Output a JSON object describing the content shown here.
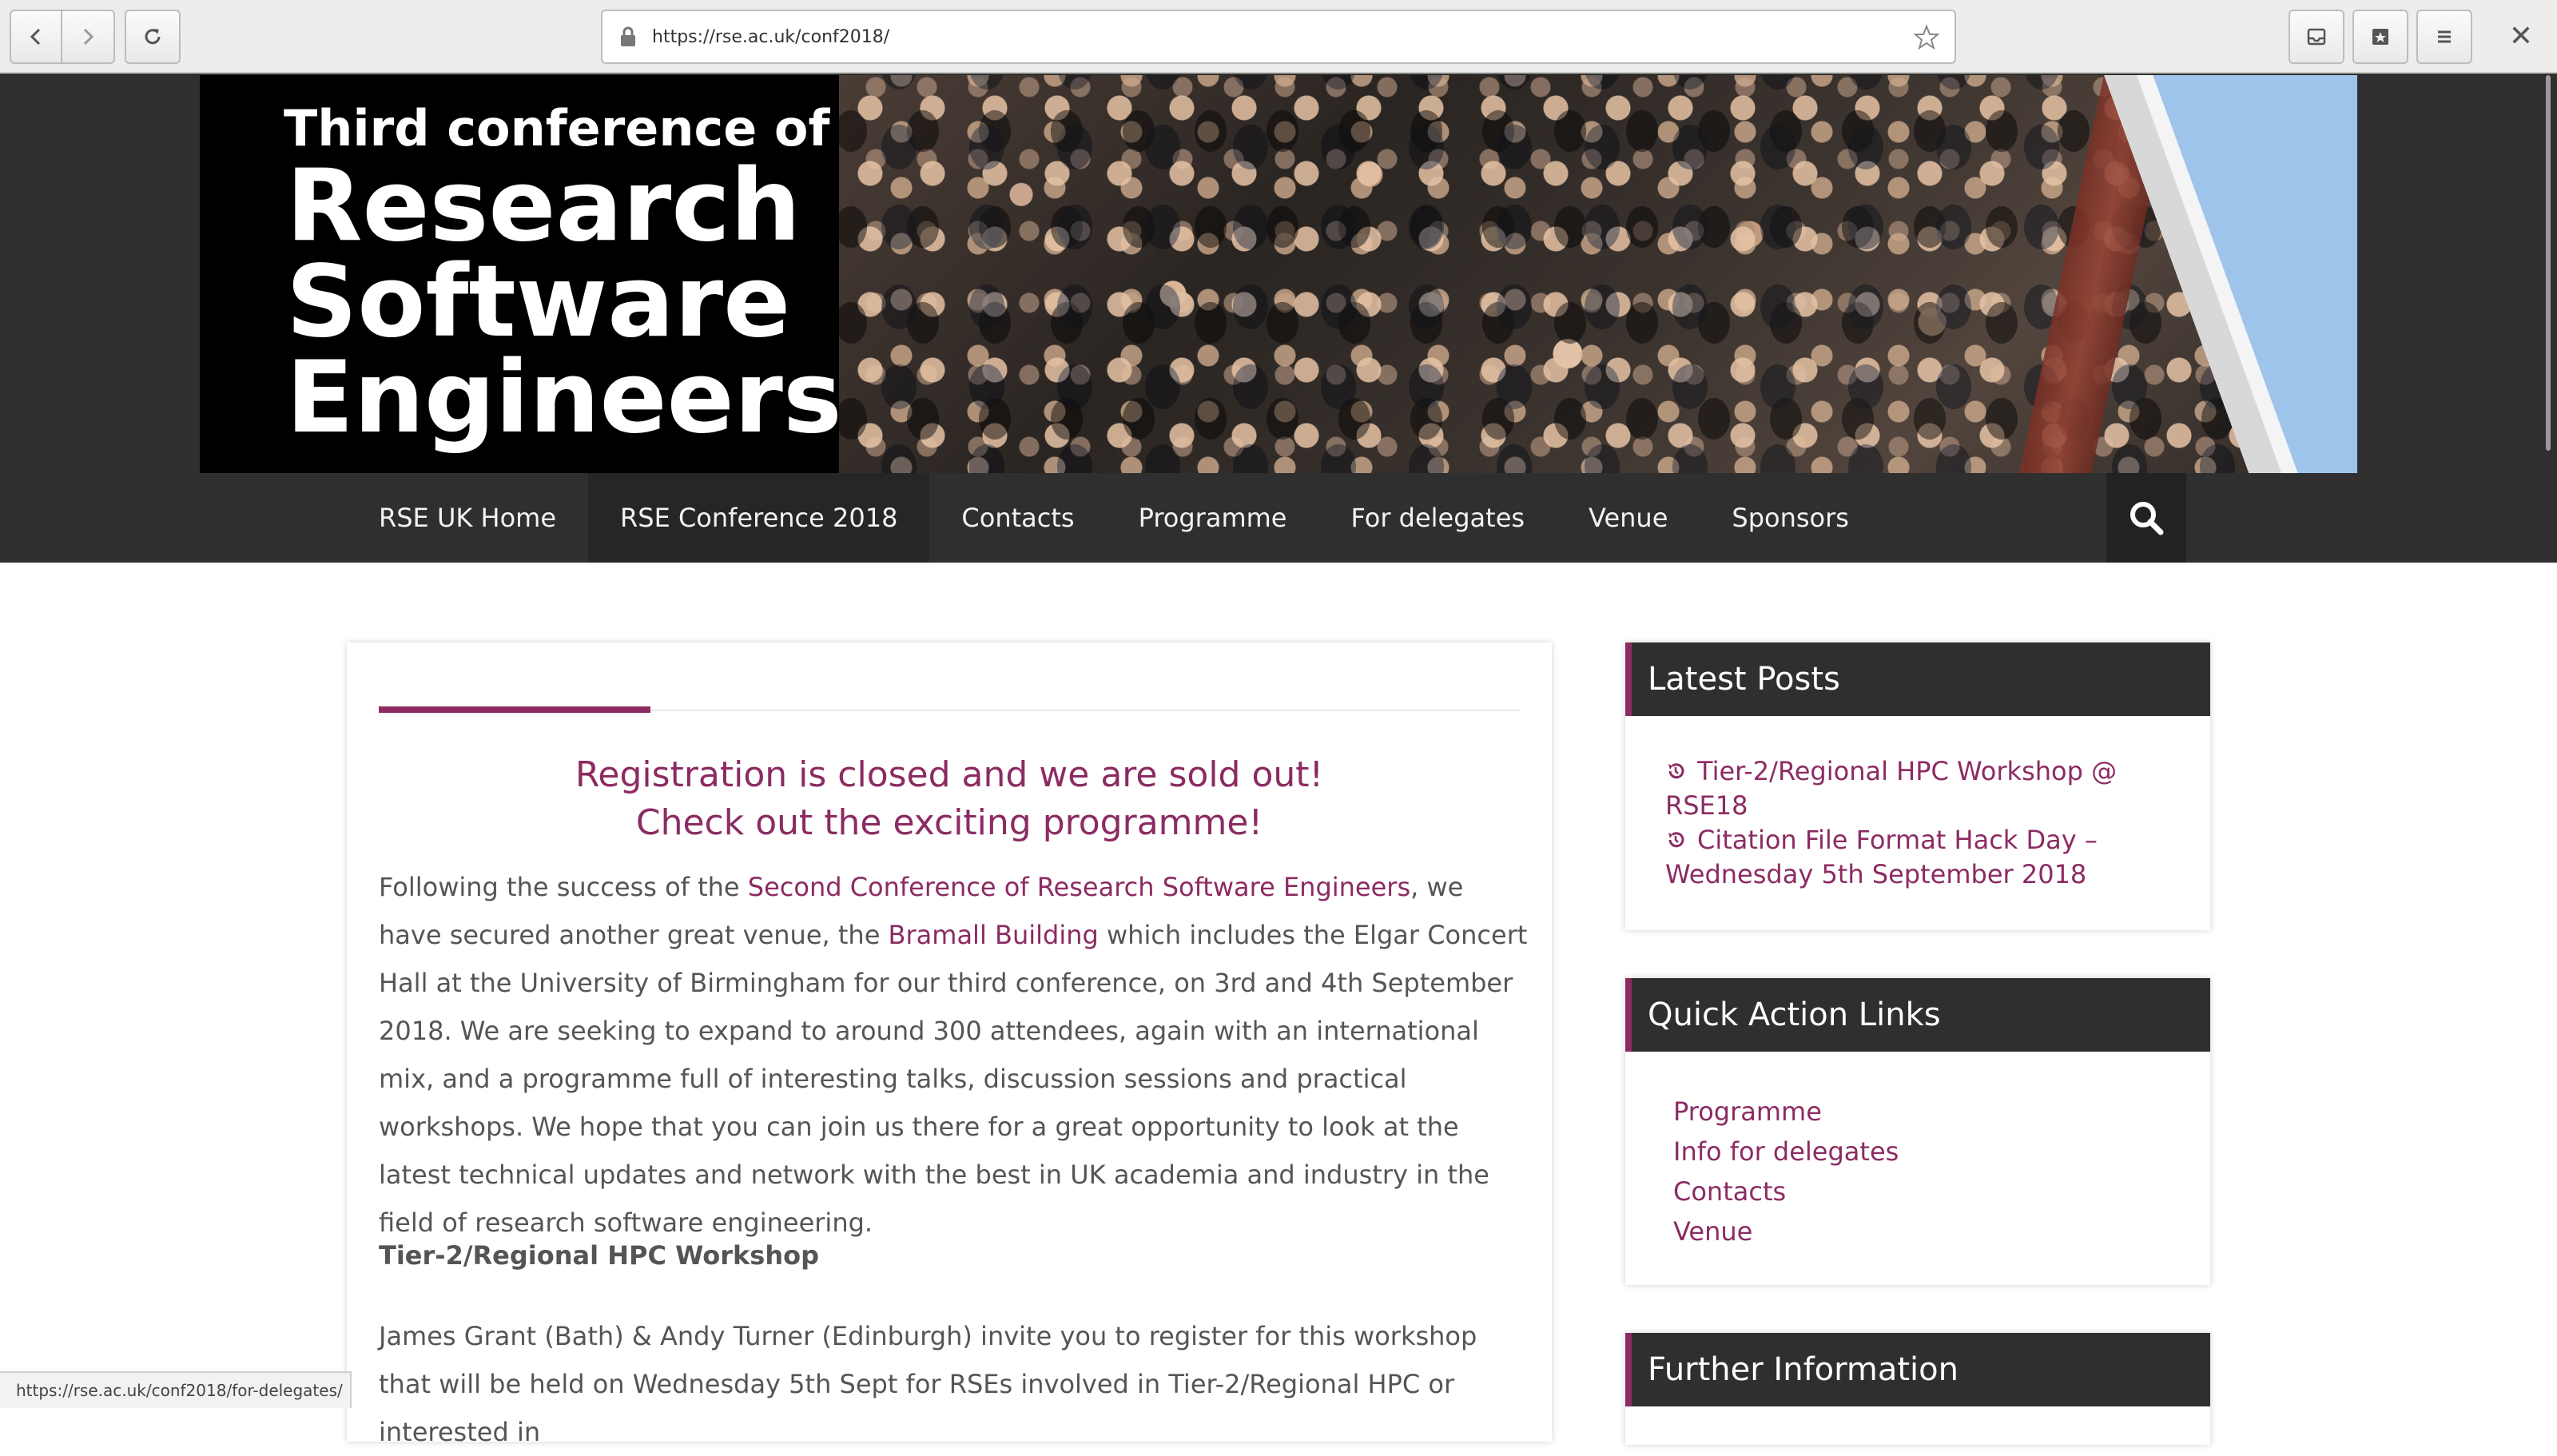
{
  "browser": {
    "url": "https://rse.ac.uk/conf2018/",
    "status_url": "https://rse.ac.uk/conf2018/for-delegates/"
  },
  "banner": {
    "line1": "Third conference of",
    "line2": "Research",
    "line3": "Software",
    "line4": "Engineers"
  },
  "nav": {
    "items": [
      {
        "label": "RSE UK Home"
      },
      {
        "label": "RSE Conference 2018"
      },
      {
        "label": "Contacts"
      },
      {
        "label": "Programme"
      },
      {
        "label": "For delegates"
      },
      {
        "label": "Venue"
      },
      {
        "label": "Sponsors"
      }
    ]
  },
  "main": {
    "headline_1": "Registration is closed and we are sold out!",
    "headline_2": "Check out the exciting programme!",
    "p1_before_link1": "Following the success of the ",
    "link1": "Second Conference of Research Software Engineers",
    "p1_between": ", we have secured another great venue, the ",
    "link2": "Bramall Building",
    "p1_after_link2": " which includes the Elgar Concert Hall at the University of Birmingham for our third conference, on 3rd and 4th September 2018. We are seeking to expand to around 300 attendees, again with an international mix, and a programme full of interesting talks, discussion sessions and practical workshops.  We hope that you can join us there for a great opportunity to look at the latest technical updates and network with the best in UK academia and industry in the field of research software engineering.",
    "section_heading": "Tier-2/Regional HPC Workshop",
    "p2": "James Grant (Bath) & Andy Turner (Edinburgh) invite you to register for this workshop that will be held on Wednesday 5th Sept for RSEs involved in Tier-2/Regional HPC or interested in"
  },
  "sidebar": {
    "latest_posts_title": "Latest Posts",
    "posts": [
      {
        "label": "Tier-2/Regional HPC Workshop @ RSE18"
      },
      {
        "label": "Citation File Format Hack Day – Wednesday 5th September 2018"
      }
    ],
    "quick_links_title": "Quick Action Links",
    "quick_links": [
      {
        "label": "Programme"
      },
      {
        "label": "Info for delegates"
      },
      {
        "label": "Contacts"
      },
      {
        "label": "Venue"
      }
    ],
    "further_info_title": "Further Information"
  },
  "colors": {
    "accent": "#8c2b62",
    "nav_bg": "#2f2f2f",
    "text": "#555555"
  },
  "icons": {
    "back": "arrow-left-icon",
    "forward": "arrow-right-icon",
    "reload": "reload-icon",
    "lock": "lock-icon",
    "bookmark": "star-icon",
    "search": "search-icon",
    "history": "history-icon"
  }
}
